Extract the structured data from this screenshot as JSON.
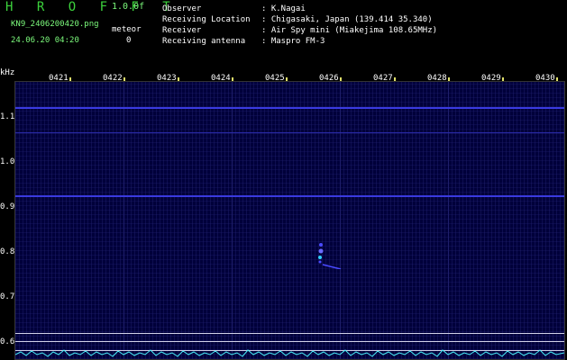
{
  "header": {
    "app_title": "H R O F F T",
    "version": "1.0.0f",
    "filename": "KN9_2406200420.png",
    "meteor_label": "meteor",
    "datetime": "24.06.20 04:20",
    "meteor_count": "0"
  },
  "info": [
    {
      "key": "Observer",
      "value": ": K.Nagai"
    },
    {
      "key": "Receiving Location",
      "value": ": Chigasaki, Japan (139.414 35.340)"
    },
    {
      "key": "Receiver",
      "value": ": Air Spy mini (Miakejima 108.65MHz)"
    },
    {
      "key": "Receiving antenna",
      "value": ": Maspro FM-3"
    }
  ],
  "axes": {
    "y_unit": "kHz",
    "y_ticks": [
      "1.1",
      "1.0",
      "0.9",
      "0.8",
      "0.7",
      "0.6"
    ],
    "x_ticks": [
      "0421",
      "0422",
      "0423",
      "0424",
      "0425",
      "0426",
      "0427",
      "0428",
      "0429",
      "0430"
    ]
  },
  "colors": {
    "title_green": "#3cd23c",
    "spectrum_background": "#00003a",
    "carrier_line": "#3a3ae0",
    "baseline_noise": "#48f0f8",
    "tick_marker": "#e8e85a"
  }
}
